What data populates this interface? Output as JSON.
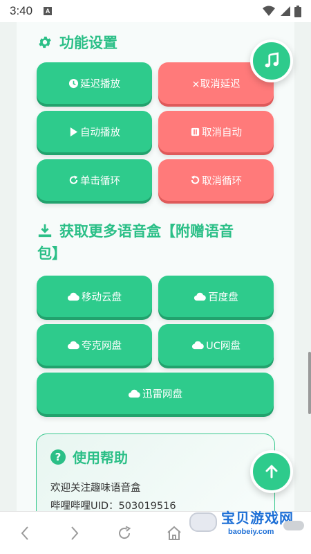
{
  "status_bar": {
    "time": "3:40",
    "app_badge": "A"
  },
  "sections": {
    "settings": {
      "title": "功能设置",
      "icon": "gear-icon"
    },
    "download": {
      "title_line1": "获取更多语音盒【附赠语音",
      "title_line2": "包】",
      "icon": "download-icon"
    }
  },
  "settings_buttons": {
    "delay_play": "延迟播放",
    "cancel_delay": "×取消延迟",
    "auto_play": "自动播放",
    "cancel_auto": "取消自动",
    "single_loop": "单击循环",
    "cancel_loop": "取消循环"
  },
  "download_buttons": {
    "mobile_cloud": "移动云盘",
    "baidu": "百度盘",
    "quark": "夸克网盘",
    "uc": "UC网盘",
    "xunlei": "迅雷网盘"
  },
  "help": {
    "title": "使用帮助",
    "line1": "欢迎关注趣味语音盒",
    "line2": "哔哩哔哩UID：503019516"
  },
  "watermark": {
    "name": "宝贝游戏网",
    "url": "baobeiy.com"
  },
  "colors": {
    "green": "#2ecb8c",
    "red": "#ff7a7a",
    "title_green": "#2bbf87"
  }
}
